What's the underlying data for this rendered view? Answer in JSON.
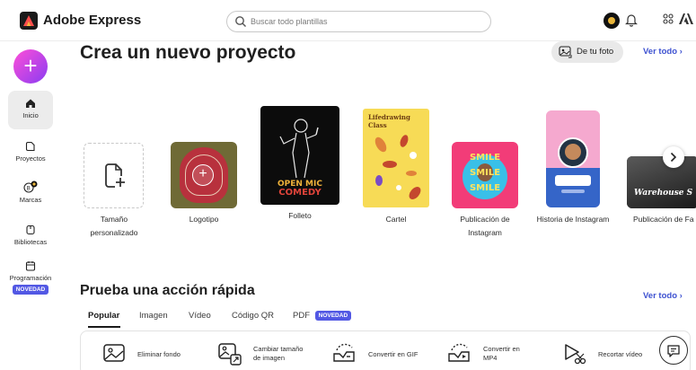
{
  "app": {
    "title": "Adobe Express"
  },
  "search": {
    "placeholder": "Buscar todo plantillas"
  },
  "rail": {
    "create_label": "+",
    "items": [
      {
        "label": "Inicio",
        "icon": "home-icon"
      },
      {
        "label": "Proyectos",
        "icon": "folder-icon"
      },
      {
        "label": "Marcas",
        "icon": "brand-icon"
      },
      {
        "label": "Bibliotecas",
        "icon": "library-icon"
      },
      {
        "label": "Programación",
        "icon": "calendar-icon",
        "badge": "NOVEDAD"
      }
    ]
  },
  "main": {
    "heading": "Crea un nuevo proyecto",
    "photo_button": "De tu foto",
    "see_all": "Ver todo",
    "cards": [
      {
        "label_line1": "Tamaño",
        "label_line2": "personalizado"
      },
      {
        "label_line1": "Logotipo"
      },
      {
        "label_line1": "Folleto",
        "thumb_text_1": "OPEN MIC",
        "thumb_text_2": "COMEDY"
      },
      {
        "label_line1": "Cartel",
        "thumb_text_1": "Lifedrawing",
        "thumb_text_2": "Class"
      },
      {
        "label_line1": "Publicación de",
        "label_line2": "Instagram",
        "thumb_text_1": "SMILE",
        "thumb_text_2": "SMILE",
        "thumb_text_3": "SMILE"
      },
      {
        "label_line1": "Historia de Instagram"
      },
      {
        "label_line1": "Publicación de Fa",
        "thumb_text_1": "Warehouse S"
      }
    ]
  },
  "quick": {
    "heading": "Prueba una acción rápida",
    "see_all": "Ver todo",
    "tabs": [
      "Popular",
      "Imagen",
      "Vídeo",
      "Código QR",
      "PDF"
    ],
    "pdf_badge": "NOVEDAD",
    "actions": [
      {
        "label_line1": "Eliminar fondo"
      },
      {
        "label_line1": "Cambiar tamaño",
        "label_line2": "de imagen"
      },
      {
        "label_line1": "Convertir en GIF"
      },
      {
        "label_line1": "Convertir en",
        "label_line2": "MP4"
      },
      {
        "label_line1": "Recortar vídeo"
      }
    ]
  },
  "colors": {
    "accent_link": "#3e52d1",
    "badge": "#5258e4",
    "create_gradient_start": "#ff4fd8",
    "create_gradient_end": "#8a3cf2"
  }
}
